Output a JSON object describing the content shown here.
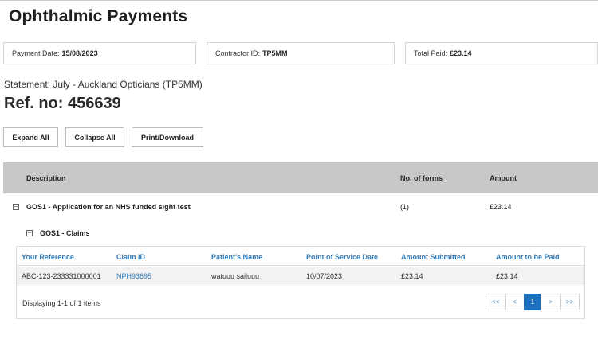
{
  "page": {
    "title": "Ophthalmic Payments"
  },
  "info": {
    "payment_date_label": "Payment Date:",
    "payment_date_value": "15/08/2023",
    "contractor_label": "Contractor ID:",
    "contractor_value": "TP5MM",
    "total_label": "Total Paid:",
    "total_value": "£23.14"
  },
  "statement": {
    "text": "Statement: July - Auckland Opticians (TP5MM)",
    "ref": "Ref. no: 456639"
  },
  "buttons": {
    "expand": "Expand All",
    "collapse": "Collapse All",
    "print": "Print/Download"
  },
  "table": {
    "headers": {
      "description": "Description",
      "forms": "No. of forms",
      "amount": "Amount"
    },
    "gos_row": {
      "toggle": "−",
      "description": "GOS1 - Application for an NHS funded sight test",
      "forms": "(1)",
      "amount": "£23.14"
    },
    "sub": {
      "toggle": "−",
      "label": "GOS1 - Claims"
    }
  },
  "claims": {
    "headers": [
      "Your Reference",
      "Claim ID",
      "Patient's Name",
      "Point of Service Date",
      "Amount Submitted",
      "Amount to be Paid"
    ],
    "rows": [
      [
        "ABC-123-233331000001",
        "NPH93695",
        "watuuu sailuuu",
        "10/07/2023",
        "£23.14",
        "£23.14"
      ]
    ],
    "displaying": "Displaying 1-1 of 1 items"
  },
  "pager": {
    "first": "<<",
    "prev": "<",
    "current": "1",
    "next": ">",
    "last": ">>"
  }
}
